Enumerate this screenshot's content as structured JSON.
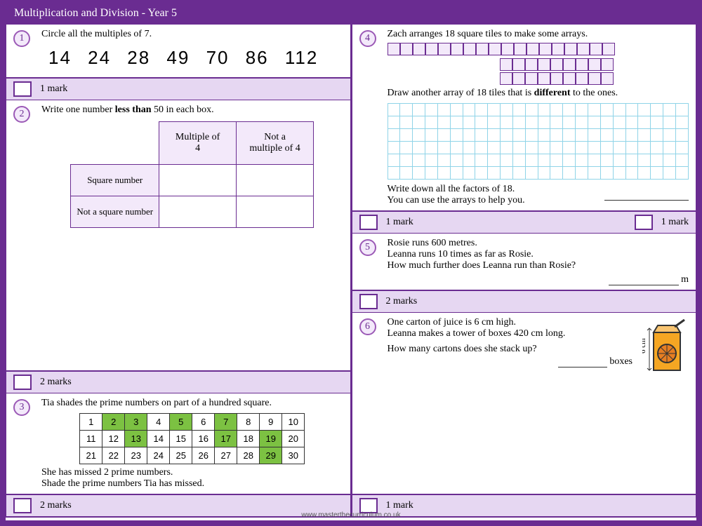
{
  "header": {
    "title": "Multiplication and Division - Year 5"
  },
  "footer": {
    "url": "www.masterthecurriculum.co.uk"
  },
  "marks": {
    "one": "1 mark",
    "two": "2 marks"
  },
  "q1": {
    "num": "1",
    "prompt": "Circle all the multiples of 7.",
    "numbers": "14   24   28   49   70   86   112"
  },
  "q2": {
    "num": "2",
    "prompt_a": "Write one number ",
    "prompt_bold": "less than",
    "prompt_b": " 50 in each box.",
    "col1": "Multiple of 4",
    "col2": "Not a multiple of 4",
    "row1": "Square number",
    "row2": "Not a square number"
  },
  "q3": {
    "num": "3",
    "prompt": "Tia shades the prime numbers on part of a hundred square.",
    "line1": "She has missed 2 prime numbers.",
    "line2": "Shade the prime numbers Tia has missed.",
    "grid": [
      [
        {
          "n": "1"
        },
        {
          "n": "2",
          "s": true
        },
        {
          "n": "3",
          "s": true
        },
        {
          "n": "4"
        },
        {
          "n": "5",
          "s": true
        },
        {
          "n": "6"
        },
        {
          "n": "7",
          "s": true
        },
        {
          "n": "8"
        },
        {
          "n": "9"
        },
        {
          "n": "10"
        }
      ],
      [
        {
          "n": "11"
        },
        {
          "n": "12"
        },
        {
          "n": "13",
          "s": true
        },
        {
          "n": "14"
        },
        {
          "n": "15"
        },
        {
          "n": "16"
        },
        {
          "n": "17",
          "s": true
        },
        {
          "n": "18"
        },
        {
          "n": "19",
          "s": true
        },
        {
          "n": "20"
        }
      ],
      [
        {
          "n": "21"
        },
        {
          "n": "22"
        },
        {
          "n": "23"
        },
        {
          "n": "24"
        },
        {
          "n": "25"
        },
        {
          "n": "26"
        },
        {
          "n": "27"
        },
        {
          "n": "28"
        },
        {
          "n": "29",
          "s": true
        },
        {
          "n": "30"
        }
      ]
    ]
  },
  "q4": {
    "num": "4",
    "prompt": "Zach arranges 18 square tiles to make some arrays.",
    "line_a": "Draw another array of 18 tiles that is ",
    "line_bold": "different",
    "line_b": " to the ones.",
    "factors1": "Write down all the factors of 18.",
    "factors2": "You can use the arrays to help you.",
    "arrays": {
      "a1": {
        "rows": 1,
        "cols": 18
      },
      "a2": {
        "rows": 2,
        "cols": 9
      }
    },
    "grid": {
      "rows": 6,
      "cols": 24
    }
  },
  "q5": {
    "num": "5",
    "l1": "Rosie runs 600 metres.",
    "l2": "Leanna runs 10 times as far as Rosie.",
    "l3": "How much further does Leanna run than Rosie?",
    "unit": "m"
  },
  "q6": {
    "num": "6",
    "l1": "One carton of juice is 6 cm high.",
    "l2": "Leanna makes a tower of boxes 420 cm long.",
    "l3": "How many cartons does she stack up?",
    "unit": "boxes",
    "dim": "6 cm"
  }
}
